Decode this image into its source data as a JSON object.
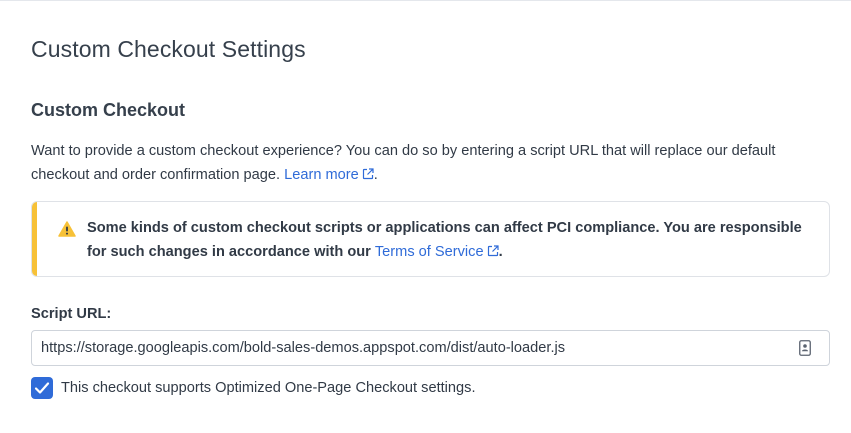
{
  "page": {
    "title": "Custom Checkout Settings"
  },
  "section": {
    "title": "Custom Checkout",
    "description_line": "Want to provide a custom checkout experience? You can do so by entering a script URL that will replace our default checkout and order confirmation page.",
    "description_prefix": "Want to provide a custom checkout experience? You can do so by entering a script URL that will replace our default checkout and order confirmation page. ",
    "learn_more_label": "Learn more",
    "description_suffix": "."
  },
  "warning": {
    "text_prefix": "Some kinds of custom checkout scripts or applications can affect PCI compliance. You are responsible for such changes in accordance with our ",
    "terms_label": "Terms of Service",
    "text_suffix": ".",
    "icon": "warning-triangle-icon",
    "accent_color": "#f7c137"
  },
  "script_url": {
    "label": "Script URL:",
    "value": "https://storage.googleapis.com/bold-sales-demos.appspot.com/dist/auto-loader.js",
    "autofill_icon": "contact-card-icon"
  },
  "optimized_checkout": {
    "checked": true,
    "label": "This checkout supports Optimized One-Page Checkout settings."
  },
  "colors": {
    "link": "#2f6bd8",
    "checkbox": "#2f6bd8",
    "text": "#313a46"
  }
}
